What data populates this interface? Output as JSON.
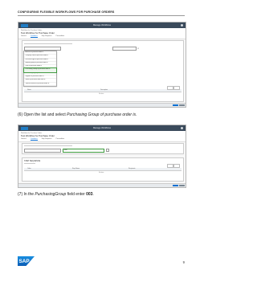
{
  "doc": {
    "header": "CONFIGURING FLEXIBLE WORKFLOWS FOR PURCHASE ORDERS",
    "page_number": "9"
  },
  "screens": {
    "shell_logo": "SAP",
    "shell_title": "Manage Workflows",
    "breadcrumb": "Workflows for Purchase Orders",
    "object_title": "Test Workflow for Purchase Order",
    "tabs": [
      "General",
      "Conditions",
      "Step Sequence",
      "Precondition"
    ]
  },
  "screen2": {
    "field_value": "003",
    "section_title": "STEP SEQUENCE"
  },
  "captions": {
    "step6": {
      "prefix": "(6) Open the list and select ",
      "emph": "Purchasing Group of purchase order is",
      "suffix": "."
    },
    "step7": {
      "prefix": "(7) In the ",
      "emph": "PurchasingGroup",
      "mid": " field enter ",
      "bold": "003",
      "suffix": "."
    }
  },
  "brand": {
    "logo_text": "SAP",
    "logo_color": "#0a6ed1"
  }
}
